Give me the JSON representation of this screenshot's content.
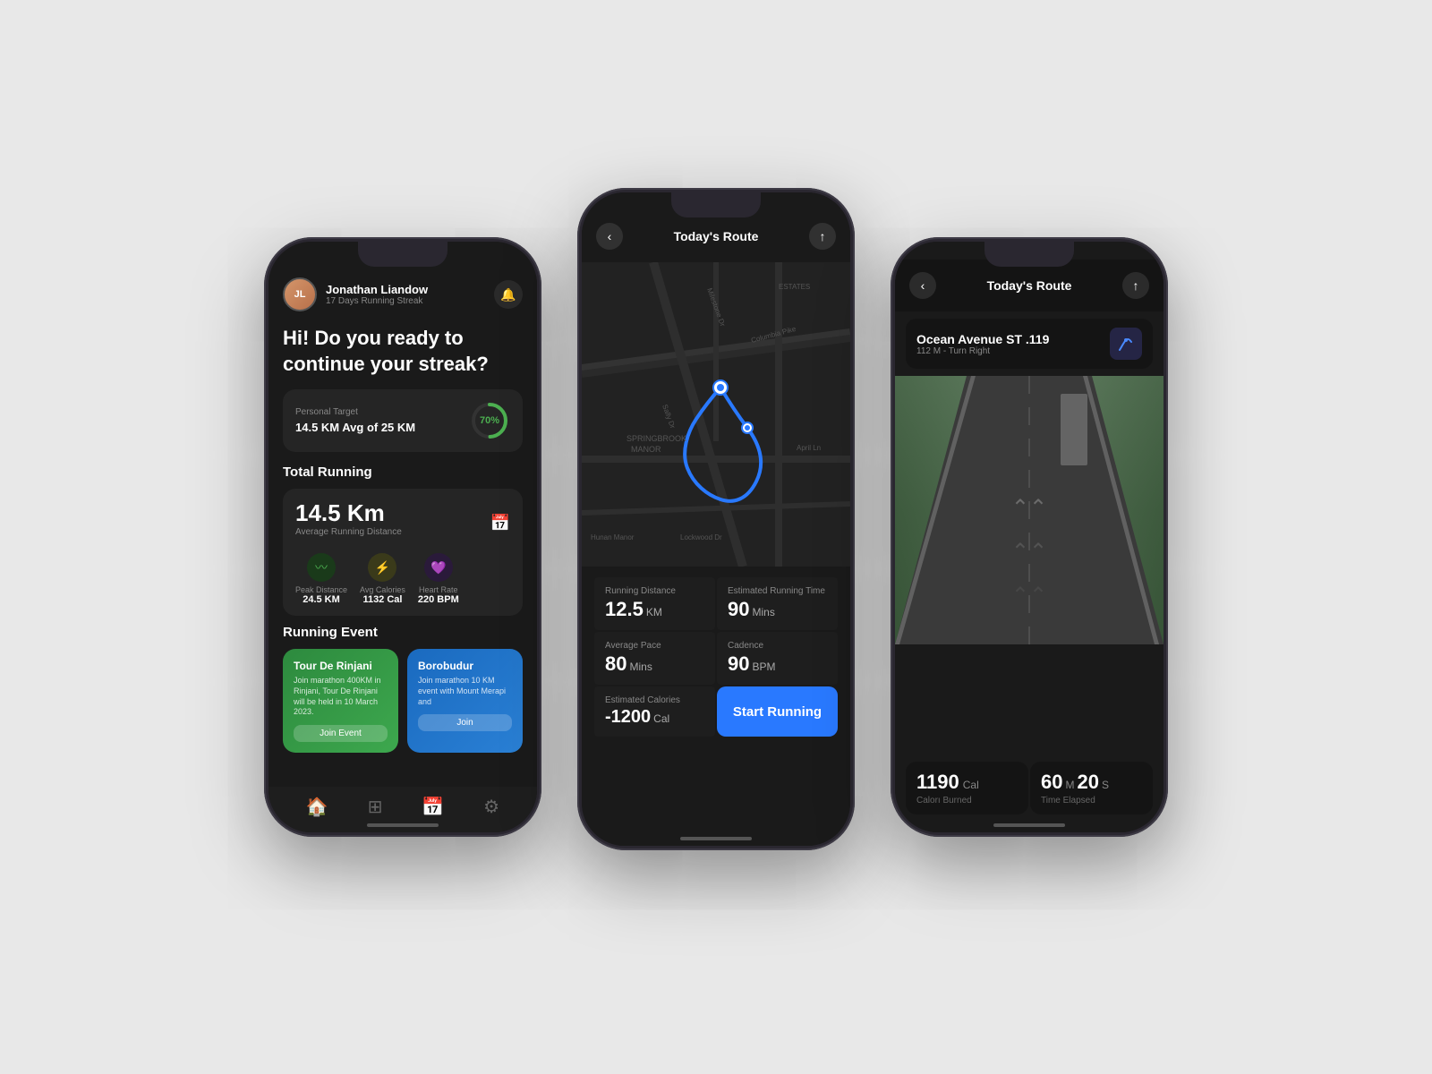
{
  "phone1": {
    "user": {
      "name": "Jonathan Liandow",
      "streak": "17 Days Running Streak",
      "avatar_initials": "JL"
    },
    "greeting": "Hi! Do you ready to continue your streak?",
    "target": {
      "label": "Personal Target",
      "value": "14.5 KM Avg of 25 KM",
      "progress": "70%"
    },
    "total_running": {
      "section_title": "Total Running",
      "km": "14.5 Km",
      "sub": "Average Running Distance",
      "stats": [
        {
          "label": "Peak Distance",
          "value": "24.5 KM",
          "icon": "〰"
        },
        {
          "label": "Avg Calories",
          "value": "1132 Cal",
          "icon": "⚡"
        },
        {
          "label": "Heart Rate",
          "value": "220 BPM",
          "icon": "💜"
        }
      ]
    },
    "running_event": {
      "section_title": "Running Event",
      "events": [
        {
          "title": "Tour De Rinjani",
          "desc": "Join marathon 400KM in Rinjani, Tour De Rinjani will be held in 10 March 2023.",
          "btn": "Join Event",
          "color": "green"
        },
        {
          "title": "Borobudur",
          "desc": "Join marathon 10 KM event with Mount Merapi and",
          "btn": "Join",
          "color": "blue"
        }
      ]
    },
    "nav": {
      "items": [
        "🏠",
        "⊞",
        "📅",
        "⚙"
      ]
    }
  },
  "phone2": {
    "header": {
      "title": "Today's Route",
      "back": "‹",
      "share": "↑"
    },
    "stats": [
      {
        "label": "Running Distance",
        "value": "12.5",
        "unit": "KM"
      },
      {
        "label": "Estimated Running Time",
        "value": "90",
        "unit": "Mins"
      },
      {
        "label": "Average Pace",
        "value": "80",
        "unit": "Mins"
      },
      {
        "label": "Cadence",
        "value": "90",
        "unit": "BPM"
      },
      {
        "label": "Estimated Calories",
        "value": "-1200",
        "unit": "Cal"
      },
      {
        "label": "start_button",
        "value": "Start Running",
        "unit": ""
      }
    ],
    "map_labels": [
      "SPRINGBROOK MANOR",
      "Columbia Pike",
      "Lockwood Dr",
      "Hunan Manor Chinese",
      "ESTATES"
    ]
  },
  "phone3": {
    "header": {
      "title": "Today's Route",
      "back": "‹",
      "share": "↑"
    },
    "street": {
      "name": "Ocean Avenue ST .119",
      "direction": "112 M - Turn Right"
    },
    "bottom_stats": [
      {
        "value": "1190",
        "unit": "Cal",
        "label": "Calorı Burned"
      },
      {
        "value": "60",
        "unit_m": "M",
        "value2": "20",
        "unit_s": "S",
        "label": "Time Elapsed"
      }
    ]
  }
}
